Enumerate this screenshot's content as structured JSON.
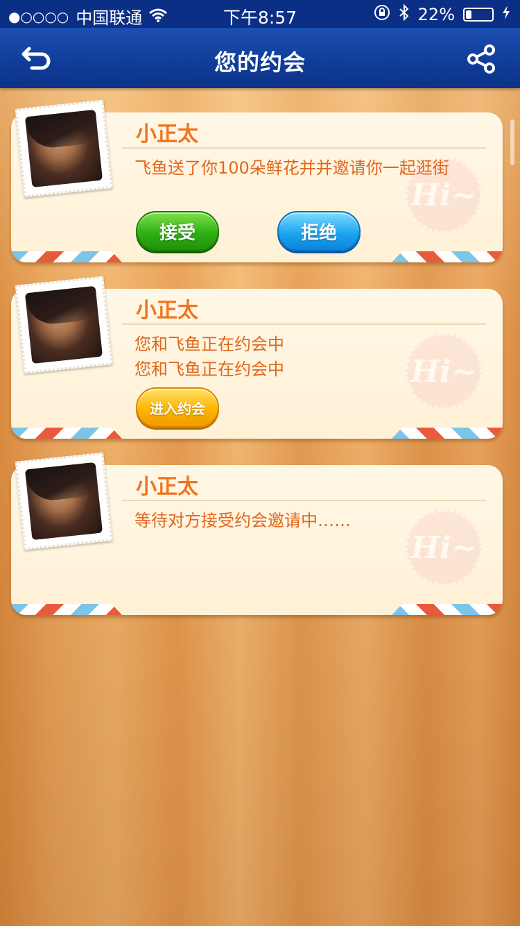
{
  "status_bar": {
    "signal": "●○○○○",
    "carrier": "中国联通",
    "time": "下午8:57",
    "battery_percent": "22%",
    "battery_level": 0.22
  },
  "nav": {
    "title": "您的约会",
    "back_icon": "back-arrow-icon",
    "share_icon": "share-icon"
  },
  "cards": [
    {
      "name": "小正太",
      "lines": [
        "飞鱼送了你100朵鲜花并并邀请你一起逛街"
      ],
      "accept_label": "接受",
      "reject_label": "拒绝",
      "badge": "Hi~"
    },
    {
      "name": "小正太",
      "lines": [
        "您和飞鱼正在约会中",
        "您和飞鱼正在约会中"
      ],
      "enter_label": "进入约会",
      "badge": "Hi~"
    },
    {
      "name": "小正太",
      "lines": [
        "等待对方接受约会邀请中……"
      ],
      "badge": "Hi~"
    }
  ],
  "colors": {
    "nav_bg": "#103c98",
    "name_orange": "#f0741c",
    "text_orange": "#e0671e",
    "accept_green": "#2fb014",
    "reject_blue": "#1fa6ef",
    "enter_yellow": "#ffb500"
  }
}
